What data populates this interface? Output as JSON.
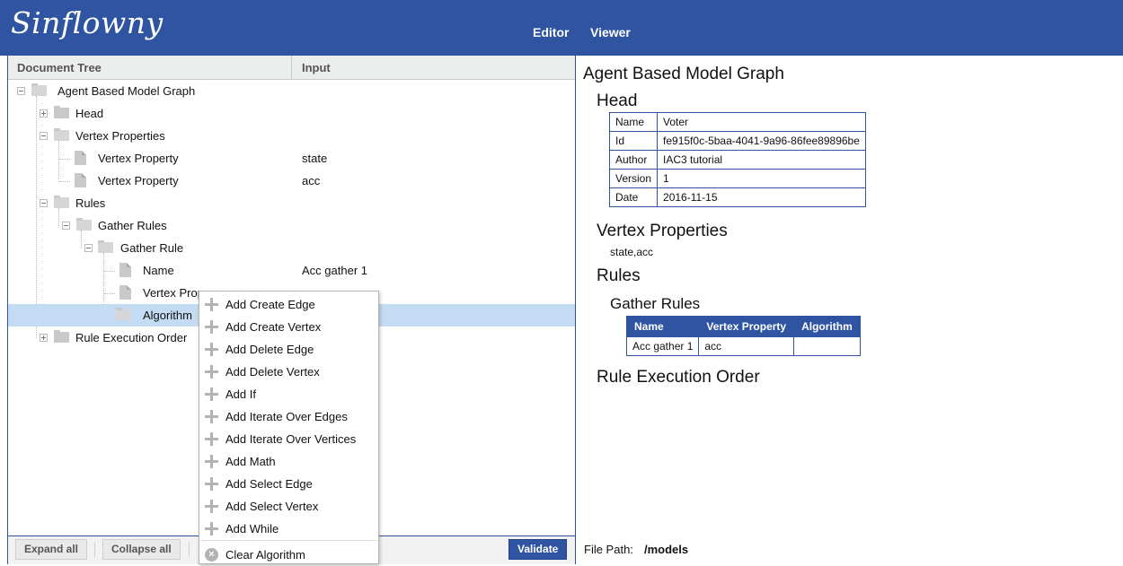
{
  "app": {
    "logo": "Sinflowny"
  },
  "nav": {
    "editor": "Editor",
    "viewer": "Viewer"
  },
  "tree": {
    "header": {
      "col1": "Document Tree",
      "col2": "Input"
    },
    "nodes": [
      {
        "label": "Agent Based Model Graph",
        "value": ""
      },
      {
        "label": "Head",
        "value": ""
      },
      {
        "label": "Vertex Properties",
        "value": ""
      },
      {
        "label": "Vertex Property",
        "value": "state"
      },
      {
        "label": "Vertex Property",
        "value": "acc"
      },
      {
        "label": "Rules",
        "value": ""
      },
      {
        "label": "Gather Rules",
        "value": ""
      },
      {
        "label": "Gather Rule",
        "value": ""
      },
      {
        "label": "Name",
        "value": "Acc gather 1"
      },
      {
        "label": "Vertex Prope",
        "value": ""
      },
      {
        "label": "Algorithm",
        "value": ""
      },
      {
        "label": "Rule Execution Order",
        "value": ""
      }
    ]
  },
  "bottom": {
    "expand_all": "Expand all",
    "collapse_all": "Collapse all",
    "validate": "Validate"
  },
  "context_menu": {
    "items": [
      "Add Create Edge",
      "Add Create Vertex",
      "Add Delete Edge",
      "Add Delete Vertex",
      "Add If",
      "Add Iterate Over Edges",
      "Add Iterate Over Vertices",
      "Add Math",
      "Add Select Edge",
      "Add Select Vertex",
      "Add While"
    ],
    "clear": "Clear Algorithm",
    "icon_add": "plus-icon",
    "icon_clear": "clear-circle-icon"
  },
  "viewer": {
    "title": "Agent Based Model Graph",
    "head_title": "Head",
    "head_rows": [
      {
        "k": "Name",
        "v": "Voter"
      },
      {
        "k": "Id",
        "v": "fe915f0c-5baa-4041-9a96-86fee89896be"
      },
      {
        "k": "Author",
        "v": "IAC3 tutorial"
      },
      {
        "k": "Version",
        "v": "1"
      },
      {
        "k": "Date",
        "v": "2016-11-15"
      }
    ],
    "vertex_props_title": "Vertex Properties",
    "vertex_props_value": "state,acc",
    "rules_title": "Rules",
    "gather_rules_title": "Gather Rules",
    "gather_headers": [
      "Name",
      "Vertex Property",
      "Algorithm"
    ],
    "gather_row": [
      "Acc gather 1",
      "acc",
      ""
    ],
    "rule_exec_title": "Rule Execution Order"
  },
  "file_path": {
    "label": "File Path:",
    "value": "/models"
  },
  "colors": {
    "brand": "#2f54a1",
    "selection": "#c4dcf3"
  }
}
